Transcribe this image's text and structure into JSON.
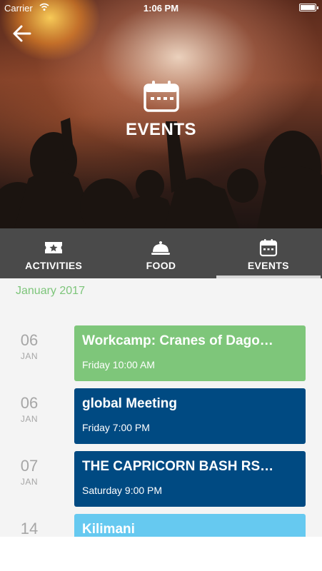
{
  "status_bar": {
    "carrier": "Carrier",
    "time": "1:06 PM"
  },
  "header": {
    "title": "EVENTS"
  },
  "tabs": [
    {
      "label": "ACTIVITIES",
      "icon": "ticket-icon",
      "active": false
    },
    {
      "label": "FOOD",
      "icon": "cloche-icon",
      "active": false
    },
    {
      "label": "EVENTS",
      "icon": "calendar-icon",
      "active": true
    }
  ],
  "month_header": "January 2017",
  "events": [
    {
      "day": "06",
      "month": "JAN",
      "title": "Workcamp: Cranes of Dago…",
      "time": "Friday 10:00 AM",
      "color": "#7ec67a"
    },
    {
      "day": "06",
      "month": "JAN",
      "title": "global Meeting",
      "time": "Friday 7:00 PM",
      "color": "#004a82"
    },
    {
      "day": "07",
      "month": "JAN",
      "title": "THE CAPRICORN BASH RS…",
      "time": "Saturday 9:00 PM",
      "color": "#004a82"
    },
    {
      "day": "14",
      "month": "",
      "title": "Kilimani",
      "time": "",
      "color": "#66c9f0"
    }
  ],
  "colors": {
    "tab_bar": "#4a4a4a",
    "month_header": "#7dc57a",
    "date_text": "#a6a6a6",
    "active_tab_indicator": "#d8d8d8"
  }
}
